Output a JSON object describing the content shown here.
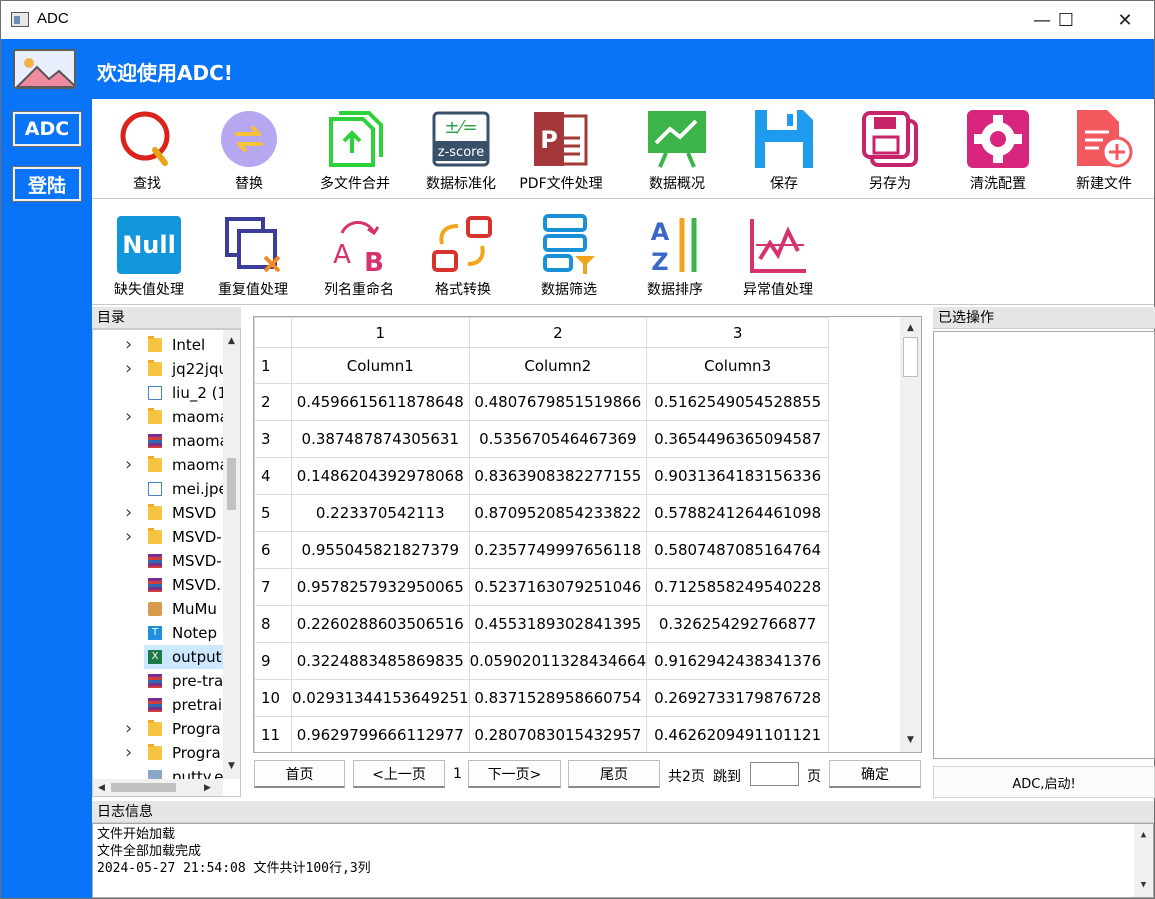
{
  "window": {
    "title": "ADC",
    "minimize": "—",
    "maximize": "☐",
    "close": "✕"
  },
  "header": {
    "welcome": "欢迎使用ADC!"
  },
  "sidebar": {
    "adc_label": "ADC",
    "login_label": "登陆"
  },
  "toolbar1": [
    {
      "label": "查找",
      "icon": "search-icon"
    },
    {
      "label": "替换",
      "icon": "replace-icon"
    },
    {
      "label": "多文件合并",
      "icon": "file-merge-icon"
    },
    {
      "label": "数据标准化",
      "icon": "zscore-icon",
      "icon_text": "z-score"
    },
    {
      "label": "PDF文件处理",
      "icon": "pdf-icon"
    },
    {
      "label": "数据概况",
      "icon": "chart-board-icon"
    },
    {
      "label": "保存",
      "icon": "save-icon"
    },
    {
      "label": "另存为",
      "icon": "save-as-icon"
    },
    {
      "label": "清洗配置",
      "icon": "wrench-gear-icon"
    },
    {
      "label": "新建文件",
      "icon": "new-file-icon"
    }
  ],
  "toolbar2": [
    {
      "label": "缺失值处理",
      "icon": "null-icon",
      "icon_text": "Null"
    },
    {
      "label": "重复值处理",
      "icon": "duplicate-icon"
    },
    {
      "label": "列名重命名",
      "icon": "rename-icon"
    },
    {
      "label": "格式转换",
      "icon": "convert-icon"
    },
    {
      "label": "数据筛选",
      "icon": "filter-icon"
    },
    {
      "label": "数据排序",
      "icon": "sort-icon"
    },
    {
      "label": "异常值处理",
      "icon": "outlier-icon"
    }
  ],
  "directory": {
    "title": "目录",
    "items": [
      {
        "name": "Intel",
        "type": "folder",
        "expandable": true
      },
      {
        "name": "jq22jqu",
        "type": "folder",
        "expandable": true
      },
      {
        "name": "liu_2 (1",
        "type": "file",
        "expandable": false
      },
      {
        "name": "maoma",
        "type": "folder",
        "expandable": true
      },
      {
        "name": "maoma",
        "type": "rar",
        "expandable": false
      },
      {
        "name": "maoma",
        "type": "folder",
        "expandable": true
      },
      {
        "name": "mei.jpe",
        "type": "file",
        "expandable": false
      },
      {
        "name": "MSVD",
        "type": "folder",
        "expandable": true
      },
      {
        "name": "MSVD-",
        "type": "folder",
        "expandable": true
      },
      {
        "name": "MSVD-",
        "type": "rar",
        "expandable": false
      },
      {
        "name": "MSVD.",
        "type": "rar",
        "expandable": false
      },
      {
        "name": "MuMu",
        "type": "box",
        "expandable": false
      },
      {
        "name": "Notep",
        "type": "notepad",
        "expandable": false
      },
      {
        "name": "output",
        "type": "excel",
        "expandable": false,
        "selected": true
      },
      {
        "name": "pre-tra",
        "type": "rar",
        "expandable": false
      },
      {
        "name": "pretrai",
        "type": "rar",
        "expandable": false
      },
      {
        "name": "Progra",
        "type": "folder",
        "expandable": true
      },
      {
        "name": "Progra",
        "type": "folder",
        "expandable": true
      },
      {
        "name": "putty.e",
        "type": "app",
        "expandable": false
      }
    ]
  },
  "table": {
    "col_numbers": [
      "1",
      "2",
      "3"
    ],
    "col_names": [
      "Column1",
      "Column2",
      "Column3"
    ],
    "header_row_label": "1",
    "rows": [
      {
        "n": "2",
        "cells": [
          "0.4596615611878648",
          "0.4807679851519866",
          "0.5162549054528855"
        ]
      },
      {
        "n": "3",
        "cells": [
          "0.387487874305631",
          "0.535670546467369",
          "0.3654496365094587"
        ]
      },
      {
        "n": "4",
        "cells": [
          "0.1486204392978068",
          "0.8363908382277155",
          "0.9031364183156336"
        ]
      },
      {
        "n": "5",
        "cells": [
          "0.223370542113",
          "0.8709520854233822",
          "0.5788241264461098"
        ]
      },
      {
        "n": "6",
        "cells": [
          "0.955045821827379",
          "0.2357749997656118",
          "0.5807487085164764"
        ]
      },
      {
        "n": "7",
        "cells": [
          "0.9578257932950065",
          "0.5237163079251046",
          "0.7125858249540228"
        ]
      },
      {
        "n": "8",
        "cells": [
          "0.2260288603506516",
          "0.4553189302841395",
          "0.326254292766877"
        ]
      },
      {
        "n": "9",
        "cells": [
          "0.3224883485869835",
          "0.05902011328434664",
          "0.9162942438341376"
        ]
      },
      {
        "n": "10",
        "cells": [
          "0.02931344153649251",
          "0.8371528958660754",
          "0.2692733179876728"
        ]
      },
      {
        "n": "11",
        "cells": [
          "0.9629799666112977",
          "0.2807083015432957",
          "0.4626209491101121"
        ]
      }
    ]
  },
  "pager": {
    "first": "首页",
    "prev": "<上一页",
    "current": "1",
    "next": "下一页>",
    "last": "尾页",
    "total": "共2页",
    "jump": "跳到",
    "page_input": "",
    "page_unit": "页",
    "confirm": "确定"
  },
  "ops": {
    "title": "已选操作",
    "start_button": "ADC,启动!"
  },
  "log": {
    "title": "日志信息",
    "lines": [
      "文件开始加载",
      "文件全部加载完成",
      "2024-05-27 21:54:08    文件共计100行,3列"
    ]
  },
  "colors": {
    "brand_blue": "#0a74f8"
  }
}
